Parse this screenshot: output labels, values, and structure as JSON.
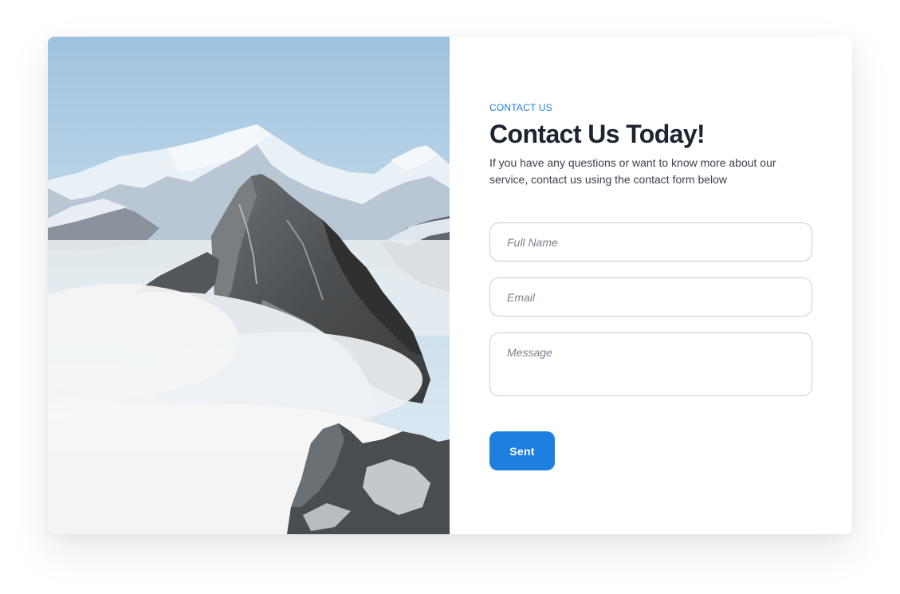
{
  "contact": {
    "eyebrow": "CONTACT US",
    "title": "Contact Us Today!",
    "subtitle": "If you have any questions or want to know more about our service,  contact us using the contact form below"
  },
  "form": {
    "name_placeholder": "Full Name",
    "email_placeholder": "Email",
    "message_placeholder": "Message",
    "submit_label": "Sent"
  },
  "colors": {
    "accent": "#1e7fe0",
    "heading": "#1c2431",
    "border": "#c9ced6"
  }
}
